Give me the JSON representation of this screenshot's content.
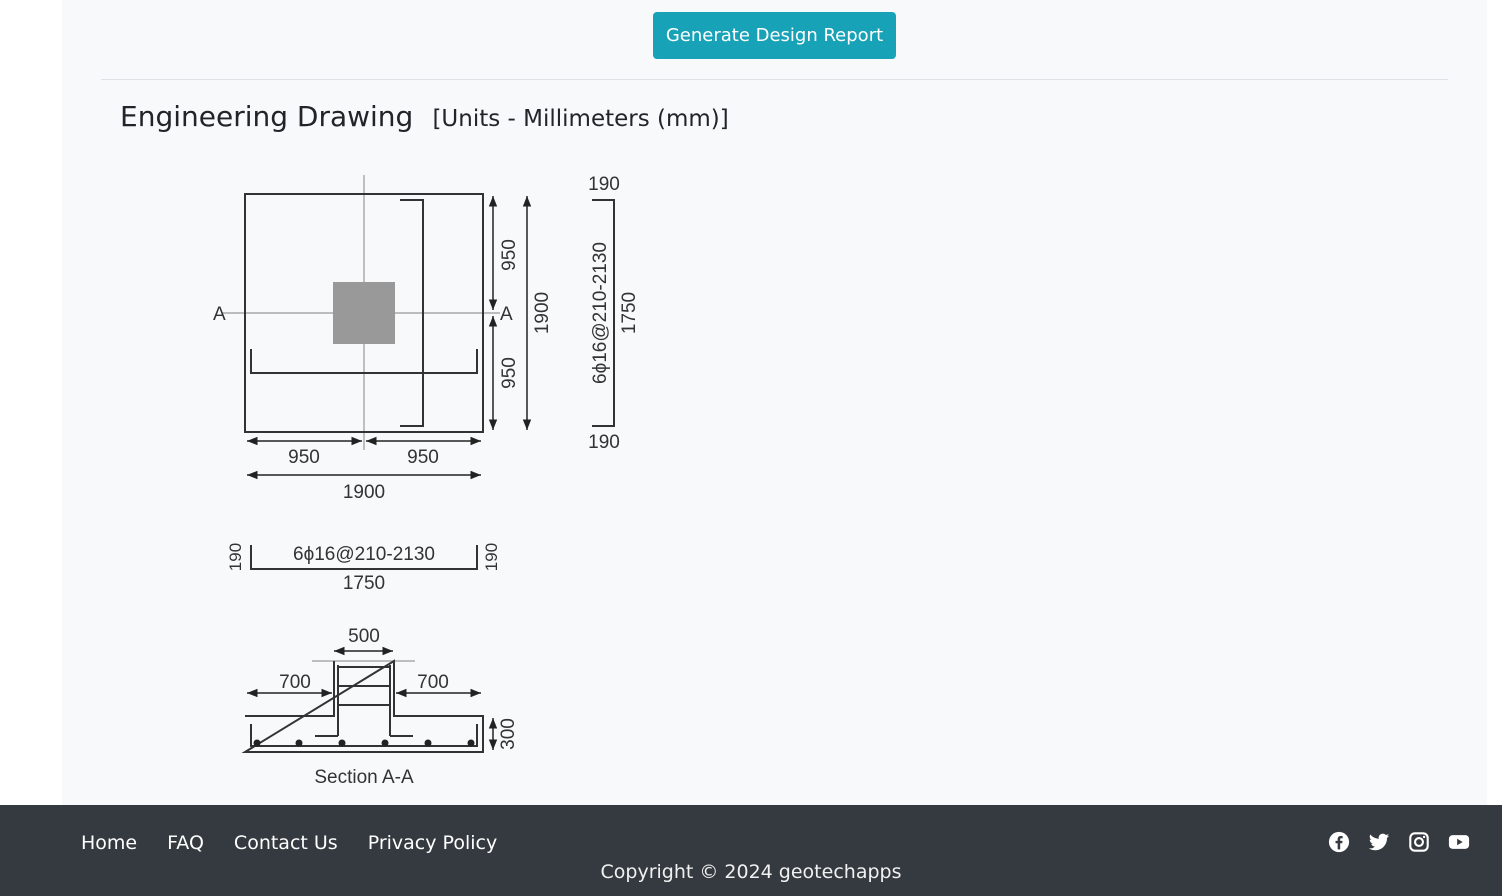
{
  "report_button": {
    "label": "Generate Design Report"
  },
  "section": {
    "title": "Engineering Drawing",
    "units": "[Units - Millimeters (mm)]"
  },
  "drawing": {
    "plan": {
      "section_marker_left": "A",
      "section_marker_right": "A",
      "dim_top_half": "950",
      "dim_bottom_half": "950",
      "dim_total_vertical": "1900",
      "dim_left_half": "950",
      "dim_right_half": "950",
      "dim_total_horizontal": "1900"
    },
    "bar_vertical": {
      "end_top": "190",
      "end_bottom": "190",
      "spec": "6ϕ16@210-2130",
      "length": "1750"
    },
    "bar_horizontal": {
      "end_left": "190",
      "end_right": "190",
      "spec": "6ϕ16@210-2130",
      "length": "1750"
    },
    "section": {
      "column_width": "500",
      "left_projection": "700",
      "right_projection": "700",
      "depth": "300",
      "caption": "Section A-A"
    }
  },
  "footer": {
    "nav": [
      "Home",
      "FAQ",
      "Contact Us",
      "Privacy Policy"
    ],
    "copyright": "Copyright © 2024 geotechapps",
    "social_icons": [
      "facebook-icon",
      "twitter-icon",
      "instagram-icon",
      "youtube-icon"
    ]
  },
  "colors": {
    "accent": "#17a2b8",
    "footer_bg": "#343a40",
    "panel_bg": "#f8f9fa"
  }
}
